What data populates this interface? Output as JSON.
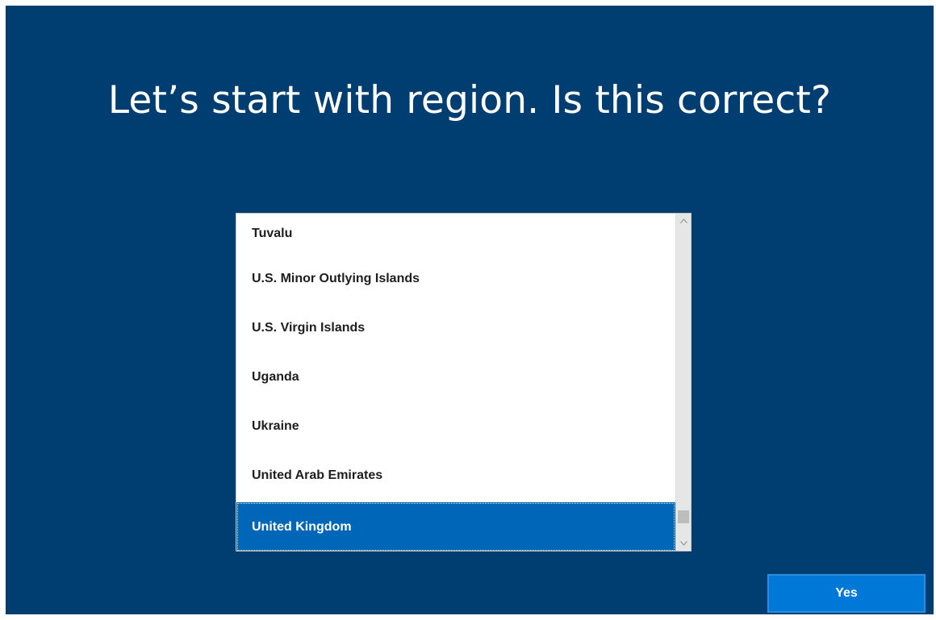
{
  "colors": {
    "background": "#003e72",
    "selection": "#0067b8",
    "button": "#0078d7",
    "list_background": "#ffffff"
  },
  "page": {
    "title": "Let’s start with region. Is this correct?"
  },
  "region_list": {
    "items": [
      "Tuvalu",
      "U.S. Minor Outlying Islands",
      "U.S. Virgin Islands",
      "Uganda",
      "Ukraine",
      "United Arab Emirates"
    ],
    "selected": "United Kingdom"
  },
  "scrollbar": {
    "up_icon": "chevron-up-icon",
    "down_icon": "chevron-down-icon"
  },
  "actions": {
    "yes_label": "Yes"
  }
}
